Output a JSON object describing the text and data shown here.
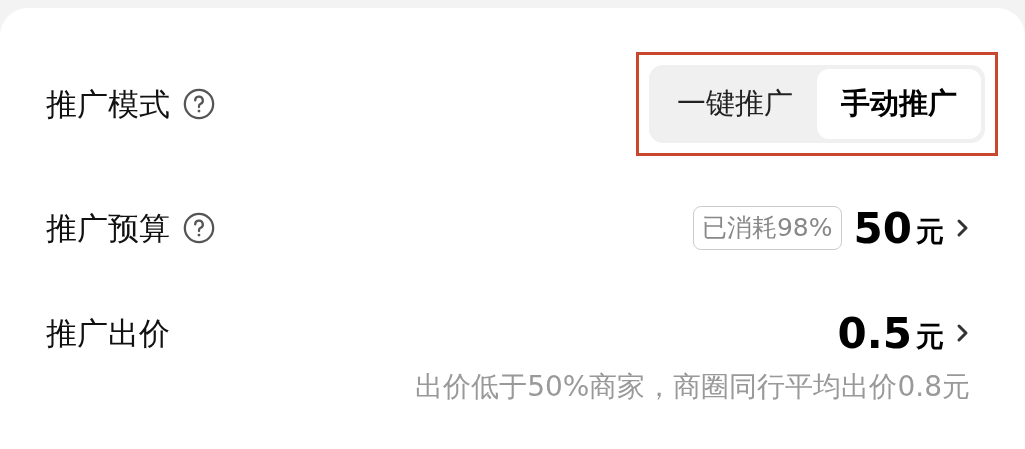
{
  "rows": [
    {
      "kind": "mode",
      "label": "推广模式",
      "help": true,
      "options": [
        {
          "label": "一键推广",
          "selected": false
        },
        {
          "label": "手动推广",
          "selected": true
        }
      ],
      "highlighted": true
    },
    {
      "kind": "value",
      "label": "推广预算",
      "help": true,
      "tag": "已消耗98%",
      "value": "50",
      "unit": "元"
    },
    {
      "kind": "value",
      "label": "推广出价",
      "help": false,
      "value": "0.5",
      "unit": "元",
      "note": "出价低于50%商家，商圈同行平均出价0.8元"
    }
  ]
}
